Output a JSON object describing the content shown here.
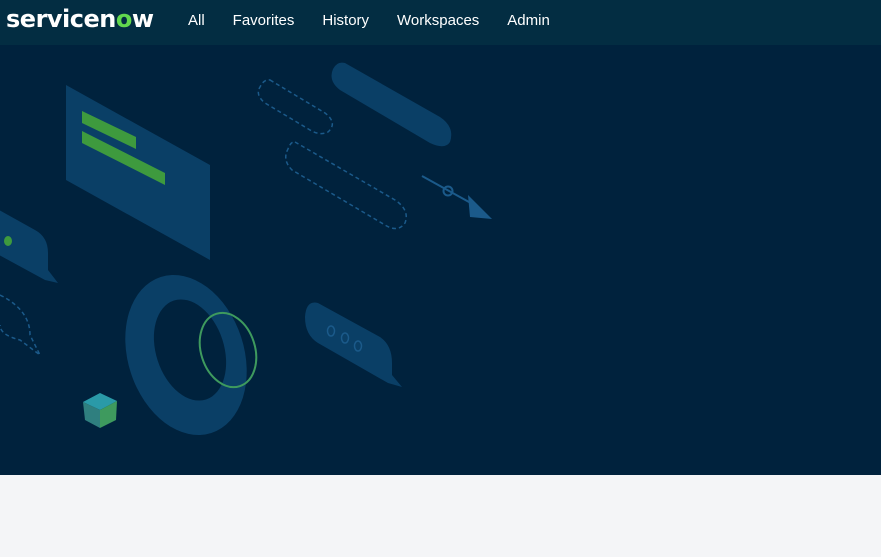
{
  "header": {
    "logo": {
      "text_main": "servicen",
      "text_o": "o",
      "text_end": "w"
    },
    "nav": [
      {
        "label": "All"
      },
      {
        "label": "Favorites"
      },
      {
        "label": "History"
      },
      {
        "label": "Workspaces"
      },
      {
        "label": "Admin"
      }
    ]
  },
  "colors": {
    "header_bg": "#032d42",
    "hero_bg": "#00223d",
    "shape_blue": "#0a3f66",
    "accent_green": "#62d84e",
    "page_bg": "#f4f5f7"
  }
}
